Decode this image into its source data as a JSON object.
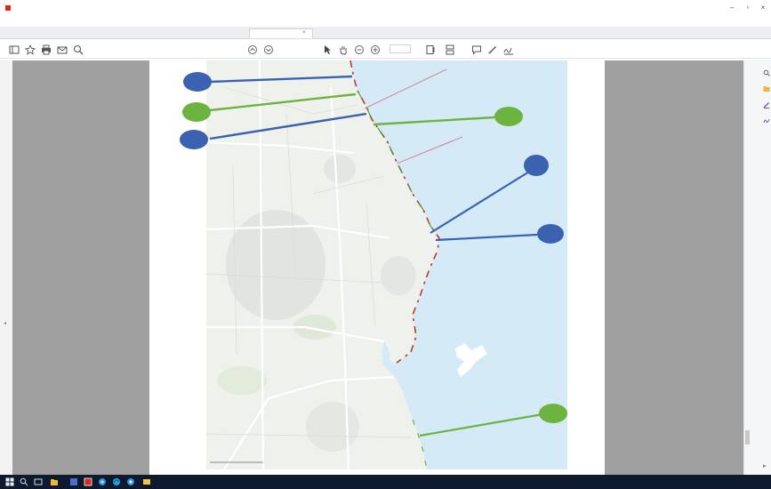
{
  "window": {
    "title": "",
    "menus": [
      "",
      "",
      "",
      "",
      "",
      ""
    ]
  },
  "tabs": [
    {
      "label": ""
    },
    {
      "label": ""
    },
    {
      "label": ""
    },
    {
      "label": ""
    },
    {
      "label": "",
      "active": true
    }
  ],
  "toolbar": {
    "page_value": "",
    "zoom_value": ""
  },
  "map": {
    "city_label": "",
    "road_labels": [
      "",
      "",
      ""
    ],
    "place_labels": [
      "",
      "",
      "",
      "",
      "",
      ""
    ],
    "markers": [
      {
        "label": "",
        "color": "#3a62b0"
      },
      {
        "label": "",
        "color": "#6db33f"
      },
      {
        "label": "",
        "color": "#3a62b0"
      },
      {
        "label": "",
        "color": "#6db33f"
      },
      {
        "label": "",
        "color": "#3a62b0"
      },
      {
        "label": "",
        "color": "#3a62b0"
      },
      {
        "label": "",
        "color": "#6db33f"
      }
    ],
    "colors": {
      "sea": "#d4ebf7",
      "land": "#eef1ec",
      "coast_accent": "#c0392b",
      "pink_line": "#d98aa0"
    }
  },
  "taskbar": {
    "time": "",
    "date": "",
    "lang": ""
  }
}
